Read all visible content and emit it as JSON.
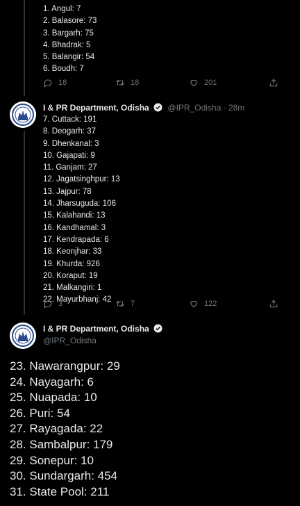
{
  "tweet1": {
    "lines": [
      "1. Angul: 7",
      "2. Balasore: 73",
      "3. Bargarh: 75",
      "4. Bhadrak: 5",
      "5. Balangir: 54",
      "6. Boudh: 7"
    ],
    "reply_count": "18",
    "retweet_count": "18",
    "like_count": "201"
  },
  "tweet2": {
    "author_name": "I & PR Department, Odisha",
    "handle": "@IPR_Odisha",
    "time": "· 28m",
    "lines": [
      "7. Cuttack: 191",
      "8. Deogarh: 37",
      "9. Dhenkanal: 3",
      "10. Gajapati: 9",
      "11. Ganjam: 27",
      "12. Jagatsinghpur: 13",
      "13. Jajpur: 78",
      "14. Jharsuguda: 106",
      "15. Kalahandi: 13",
      "16. Kandhamal: 3",
      "17. Kendrapada: 6",
      "18. Keonjhar: 33",
      "19. Khurda: 926",
      "20. Koraput: 19",
      "21. Malkangiri: 1",
      "22. Mayurbhanj: 42"
    ],
    "reply_count": "3",
    "retweet_count": "7",
    "like_count": "122"
  },
  "tweet3": {
    "author_name": "I & PR Department, Odisha",
    "handle": "@IPR_Odisha",
    "lines": [
      "23. Nawarangpur: 29",
      "24. Nayagarh: 6",
      "25. Nuapada: 10",
      "26. Puri: 54",
      "27. Rayagada: 22",
      "28. Sambalpur: 179",
      "29. Sonepur: 10",
      "30. Sundargarh: 454",
      "31. State Pool: 211"
    ]
  },
  "icons": [
    "reply-icon",
    "retweet-icon",
    "like-icon",
    "share-icon",
    "verified-badge-icon",
    "odisha-emblem-avatar"
  ],
  "colors": {
    "background": "#000000",
    "text": "#e7e9ea",
    "muted": "#71767b",
    "line": "#2f3336"
  }
}
